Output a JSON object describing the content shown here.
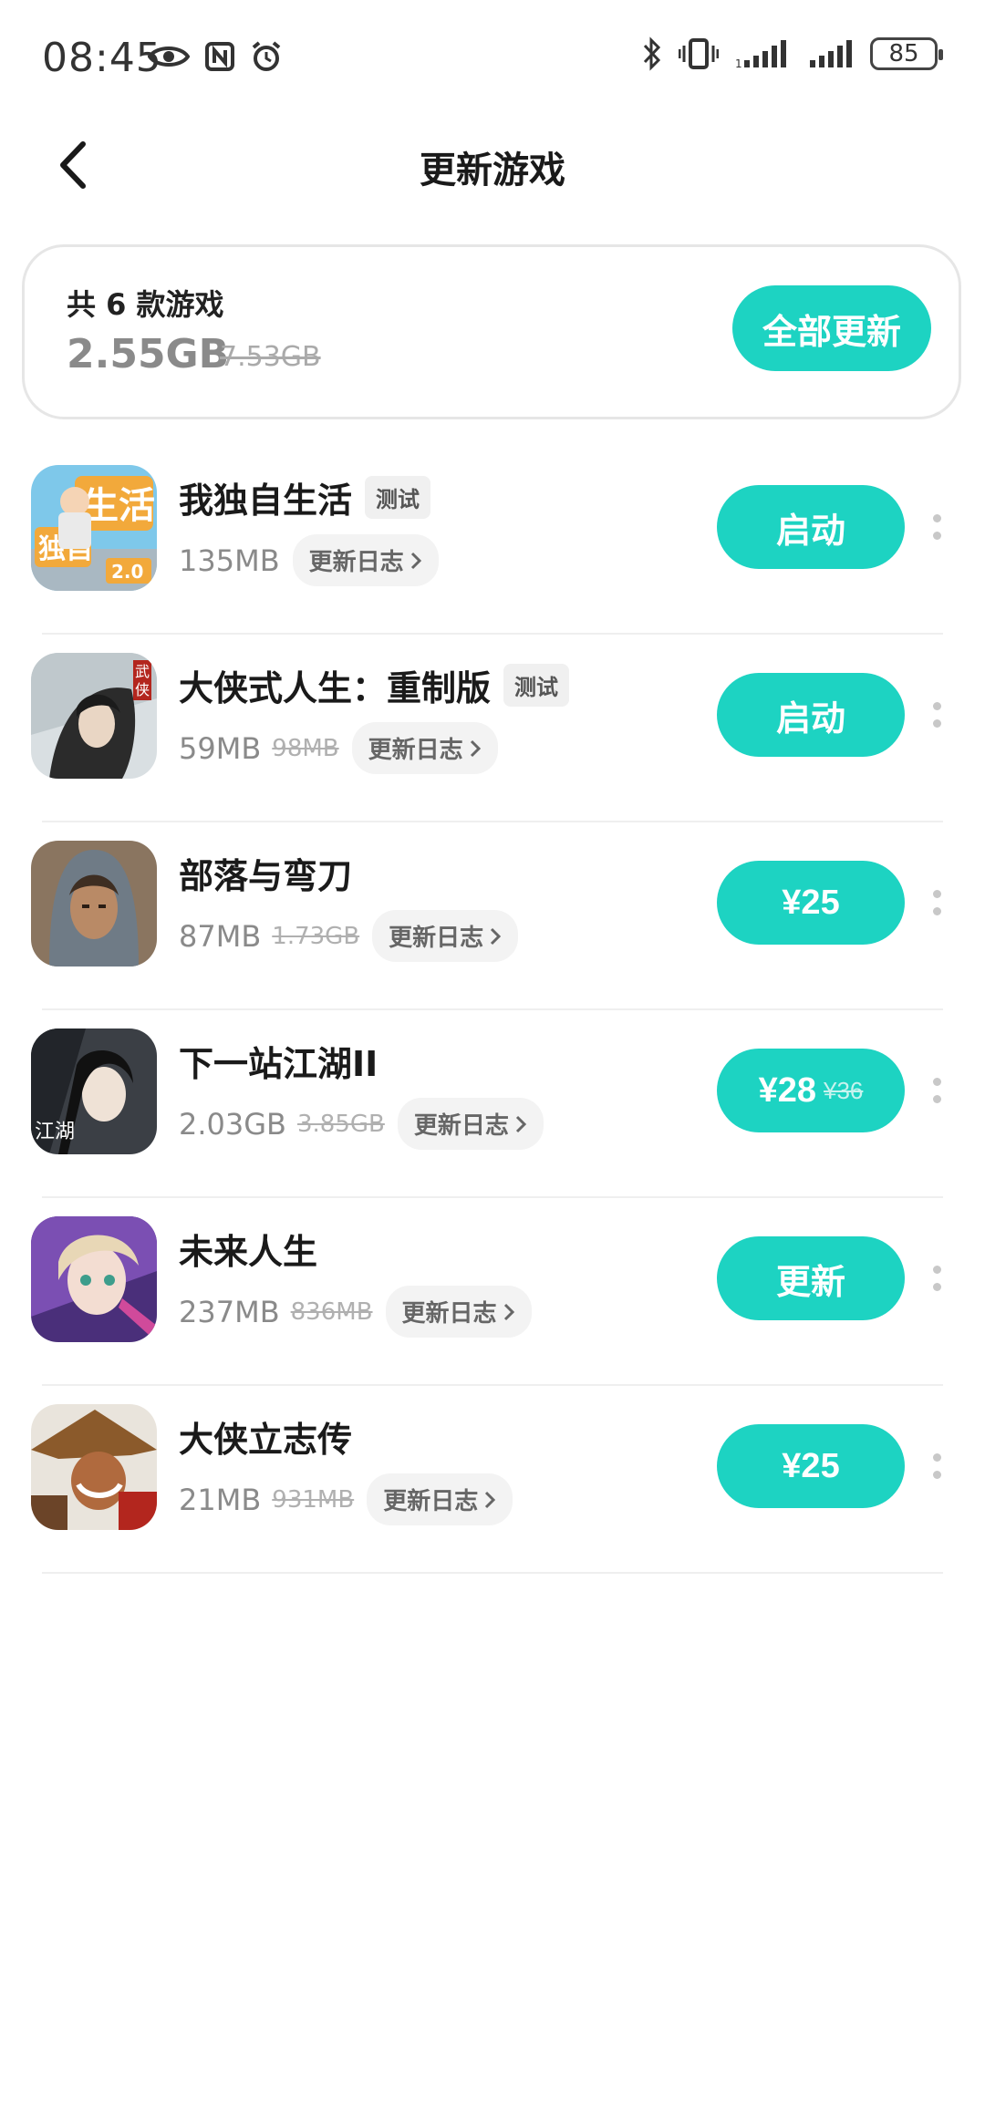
{
  "status_bar": {
    "time": "08:45",
    "battery": "85"
  },
  "header": {
    "title": "更新游戏"
  },
  "summary": {
    "count_label": "共 6 款游戏",
    "size": "2.55GB",
    "original_size": "7.53GB",
    "update_all_label": "全部更新"
  },
  "games": [
    {
      "name": "我独自生活",
      "tag": "测试",
      "size": "135MB",
      "original_size": "",
      "changelog": "更新日志",
      "action": "启动",
      "action_old_price": ""
    },
    {
      "name": "大侠式人生：重制版",
      "tag": "测试",
      "size": "59MB",
      "original_size": "98MB",
      "changelog": "更新日志",
      "action": "启动",
      "action_old_price": ""
    },
    {
      "name": "部落与弯刀",
      "tag": "",
      "size": "87MB",
      "original_size": "1.73GB",
      "changelog": "更新日志",
      "action": "¥25",
      "action_old_price": ""
    },
    {
      "name": "下一站江湖II",
      "tag": "",
      "size": "2.03GB",
      "original_size": "3.85GB",
      "changelog": "更新日志",
      "action": "¥28",
      "action_old_price": "¥36"
    },
    {
      "name": "未来人生",
      "tag": "",
      "size": "237MB",
      "original_size": "836MB",
      "changelog": "更新日志",
      "action": "更新",
      "action_old_price": ""
    },
    {
      "name": "大侠立志传",
      "tag": "",
      "size": "21MB",
      "original_size": "931MB",
      "changelog": "更新日志",
      "action": "¥25",
      "action_old_price": ""
    }
  ],
  "colors": {
    "accent": "#1dd3c2",
    "muted_text": "#8a8a8a",
    "divider": "#efefef"
  }
}
